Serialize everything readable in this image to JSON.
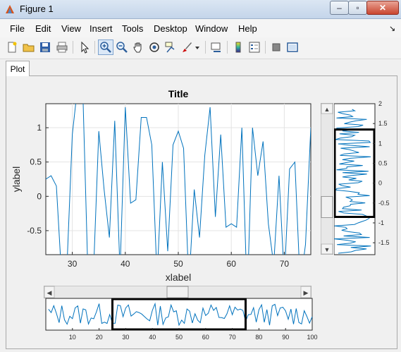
{
  "window": {
    "title": "Figure 1",
    "minimize": "–",
    "maximize": "▫",
    "close": "✕"
  },
  "menu": [
    "File",
    "Edit",
    "View",
    "Insert",
    "Tools",
    "Desktop",
    "Window",
    "Help"
  ],
  "menu_arrow": "↘",
  "toolbar": {
    "icons": [
      "new-figure-icon",
      "open-icon",
      "save-icon",
      "print-icon",
      "pointer-icon",
      "zoom-in-icon",
      "zoom-out-icon",
      "pan-icon",
      "rotate-3d-icon",
      "data-cursor-icon",
      "brush-icon",
      "brush-dropdown-icon",
      "link-plot-icon",
      "colorbar-icon",
      "legend-icon",
      "hide-tools-icon",
      "show-tools-icon"
    ],
    "active": "zoom-in-icon"
  },
  "tab": {
    "label": "Plot"
  },
  "colors": {
    "line": "#0072bd",
    "selection": "#000000",
    "titlebar": "#c4d5ea",
    "close": "#c9462f"
  },
  "chart_data": [
    {
      "type": "line",
      "title": "Title",
      "xlabel": "xlabel",
      "ylabel": "ylabel",
      "xlim": [
        25,
        75
      ],
      "ylim": [
        -0.85,
        1.35
      ],
      "xticks": [
        30,
        40,
        50,
        60,
        70
      ],
      "yticks": [
        -0.5,
        0,
        0.5,
        1
      ],
      "ytick_labels": [
        "-0.5",
        "0",
        "0.5",
        "1"
      ],
      "grid": true,
      "series": [
        {
          "x": [
            25,
            26,
            27,
            28,
            29,
            30,
            31,
            32,
            33,
            34,
            35,
            36,
            37,
            38,
            39,
            40,
            41,
            42,
            43,
            44,
            45,
            46,
            47,
            48,
            49,
            50,
            51,
            52,
            53,
            54,
            55,
            56,
            57,
            58,
            59,
            60,
            61,
            62,
            63,
            64,
            65,
            66,
            67,
            68,
            69,
            70,
            71,
            72,
            73,
            74,
            75
          ],
          "values": [
            0.25,
            0.3,
            0.15,
            -1.2,
            -1.0,
            0.9,
            1.6,
            1.5,
            -1.3,
            -1.1,
            0.95,
            0.1,
            -0.6,
            1.1,
            -1.1,
            1.3,
            -0.1,
            -0.05,
            1.15,
            1.15,
            0.75,
            -1.2,
            0.5,
            -0.8,
            0.75,
            0.95,
            0.7,
            -1.3,
            0.1,
            -0.6,
            0.6,
            1.3,
            -0.3,
            0.9,
            -0.45,
            -0.4,
            -0.45,
            1.0,
            -1.5,
            1.0,
            0.3,
            0.8,
            -0.4,
            -1.0,
            0.3,
            -1.2,
            0.4,
            0.5,
            -1.3,
            -0.7,
            1.0
          ]
        }
      ]
    },
    {
      "type": "line",
      "title": "",
      "xlabel": "",
      "ylabel": "",
      "orientation": "vertical",
      "ylim": [
        -1.8,
        2.0
      ],
      "yticks": [
        -1.5,
        -1,
        -0.5,
        0,
        0.5,
        1,
        1.5,
        2
      ],
      "ytick_labels": [
        "-1.5",
        "-1",
        "-0.5",
        "0",
        "0.5",
        "1",
        "1.5",
        "2"
      ],
      "selection": [
        -0.85,
        1.35
      ]
    },
    {
      "type": "line",
      "title": "",
      "xlabel": "",
      "ylabel": "",
      "xlim": [
        0,
        100
      ],
      "xticks": [
        10,
        20,
        30,
        40,
        50,
        60,
        70,
        80,
        90,
        100
      ],
      "selection": [
        25,
        75
      ]
    }
  ],
  "slider": {
    "value_fraction": 0.5,
    "left_arrow": "◀",
    "right_arrow": "▶"
  },
  "vslider": {
    "value_fraction": 0.5,
    "up_arrow": "▲",
    "down_arrow": "▼"
  }
}
